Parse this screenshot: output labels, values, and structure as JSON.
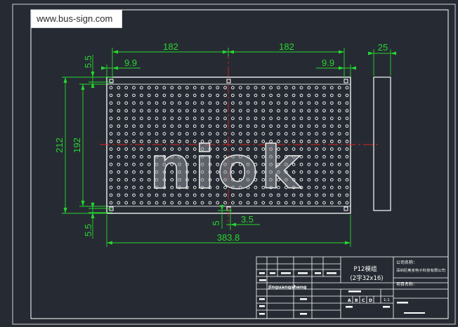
{
  "watermark_url": "www.bus-sign.com",
  "watermark_logo_text": "niok",
  "dimensions": {
    "total_width_left": "182",
    "total_width_right": "182",
    "edge_offset_left": "9.9",
    "edge_offset_right": "9.9",
    "thickness": "25",
    "top_margin": "5.5",
    "bottom_margin": "5.5",
    "overall_height": "212",
    "inner_height": "192",
    "hole_offset": "5",
    "hole_pitch": "3.5",
    "overall_length": "383.8"
  },
  "title_block": {
    "drawing_title": "P12模组",
    "drawing_subtitle": "(2字32x16)",
    "company_label": "公司名称：",
    "company_value": "深圳尼奥克电子科技有限公司",
    "project_label": "项目名称：",
    "designer": "Jinguangsheng",
    "scale": "1:1",
    "status_letters": [
      "A",
      "B",
      "C",
      "D"
    ]
  },
  "colors": {
    "background": "#262b33",
    "frame": "#ffffff",
    "dimension": "#27d62f",
    "center_line": "#e02020",
    "outline": "#ffffff"
  }
}
